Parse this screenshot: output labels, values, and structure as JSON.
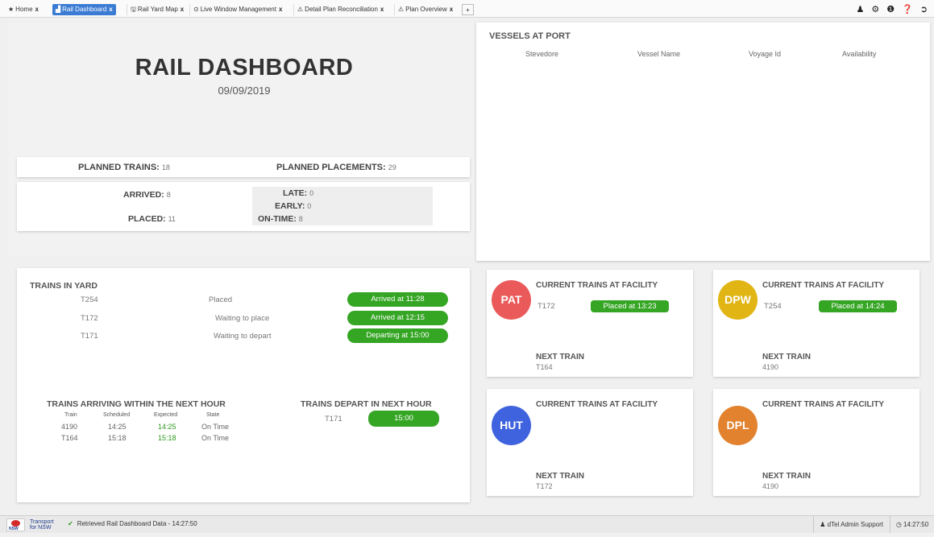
{
  "tabs": [
    {
      "icon": "★",
      "label": "Home",
      "close": "x"
    },
    {
      "icon": "▟",
      "label": "Rail Dashboard",
      "close": "x"
    },
    {
      "icon": "🖫",
      "label": "Rail Yard Map",
      "close": "x"
    },
    {
      "icon": "⊙",
      "label": "Live Window Management",
      "close": "x"
    },
    {
      "icon": "⚠",
      "label": "Detail Plan Reconciliation",
      "close": "x"
    },
    {
      "icon": "⚠",
      "label": "Plan Overview",
      "close": "x"
    }
  ],
  "new_tab_label": "+",
  "top_icons": [
    "user-icon",
    "gear-icon",
    "info-icon",
    "help-icon",
    "logout-icon"
  ],
  "header": {
    "title": "RAIL DASHBOARD",
    "date": "09/09/2019"
  },
  "planned": {
    "trains_label": "PLANNED TRAINS:",
    "trains_value": "18",
    "placements_label": "PLANNED PLACEMENTS:",
    "placements_value": "29"
  },
  "arrivals": {
    "arrived_label": "ARRIVED:",
    "arrived_value": "8",
    "placed_label": "PLACED:",
    "placed_value": "11",
    "late_label": "LATE:",
    "late_value": "0",
    "early_label": "EARLY:",
    "early_value": "0",
    "ontime_label": "ON-TIME:",
    "ontime_value": "8"
  },
  "vessels": {
    "title": "VESSELS AT PORT",
    "columns": [
      "Stevedore",
      "Vessel Name",
      "Voyage Id",
      "Availability"
    ]
  },
  "yard": {
    "title": "TRAINS IN YARD",
    "rows": [
      {
        "train": "T254",
        "status": "Placed",
        "action": "Arrived at 11:28"
      },
      {
        "train": "T172",
        "status": "Waiting to place",
        "action": "Arrived at 12:15"
      },
      {
        "train": "T171",
        "status": "Waiting to depart",
        "action": "Departing at 15:00"
      }
    ]
  },
  "arriving": {
    "title": "TRAINS ARRIVING WITHIN THE NEXT HOUR",
    "columns": [
      "Train",
      "Scheduled",
      "Expected",
      "State"
    ],
    "rows": [
      {
        "train": "4190",
        "scheduled": "14:25",
        "expected": "14:25",
        "state": "On Time"
      },
      {
        "train": "T164",
        "scheduled": "15:18",
        "expected": "15:18",
        "state": "On Time"
      }
    ]
  },
  "departing": {
    "title": "TRAINS DEPART IN NEXT HOUR",
    "train": "T171",
    "time": "15:00"
  },
  "facilities": [
    {
      "code": "PAT",
      "color": "#ea5a5a",
      "heading": "CURRENT TRAINS AT FACILITY",
      "train": "T172",
      "placed": "Placed at 13:23",
      "next_label": "NEXT TRAIN",
      "next_train": "T164"
    },
    {
      "code": "DPW",
      "color": "#e0b514",
      "heading": "CURRENT TRAINS AT FACILITY",
      "train": "T254",
      "placed": "Placed at 14:24",
      "next_label": "NEXT TRAIN",
      "next_train": "4190"
    },
    {
      "code": "HUT",
      "color": "#3f62de",
      "heading": "CURRENT TRAINS AT FACILITY",
      "train": "",
      "placed": "",
      "next_label": "NEXT TRAIN",
      "next_train": "T172"
    },
    {
      "code": "DPL",
      "color": "#e2822e",
      "heading": "CURRENT TRAINS AT FACILITY",
      "train": "",
      "placed": "",
      "next_label": "NEXT TRAIN",
      "next_train": "4190"
    }
  ],
  "status": {
    "logo_line1": "Transport",
    "logo_line2": "for NSW",
    "logo_nsw": "NSW",
    "message": "Retrieved Rail Dashboard Data - 14:27:50",
    "user": "dTel Admin Support",
    "clock": "14:27:50"
  },
  "colors": {
    "accent": "#3b7bd4",
    "pill_green": "#35a524"
  }
}
